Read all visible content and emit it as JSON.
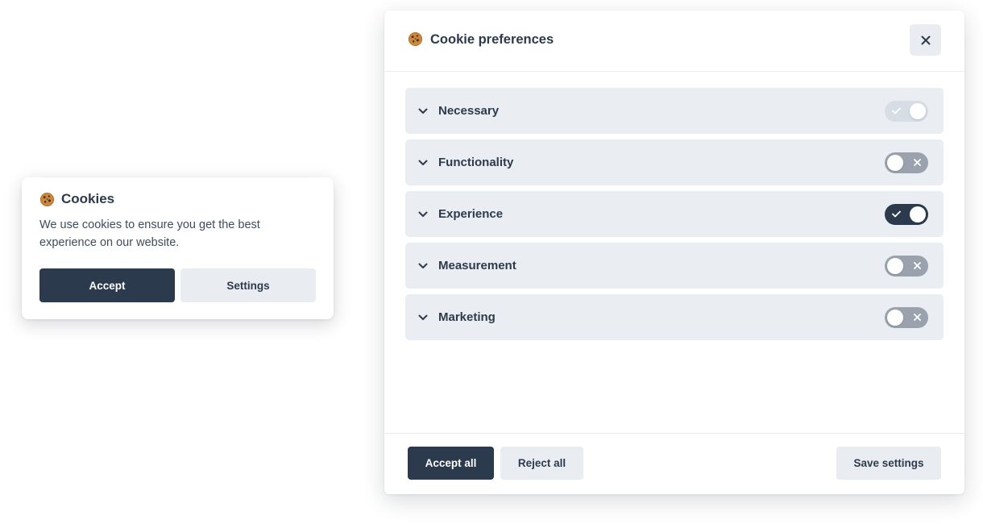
{
  "banner": {
    "icon": "cookie-icon",
    "title": "Cookies",
    "text": "We use cookies to ensure you get the best experience on our website.",
    "accept_label": "Accept",
    "settings_label": "Settings"
  },
  "modal": {
    "icon": "cookie-icon",
    "title": "Cookie preferences",
    "close_icon": "close-icon",
    "categories": [
      {
        "label": "Necessary",
        "state": "on-disabled"
      },
      {
        "label": "Functionality",
        "state": "off"
      },
      {
        "label": "Experience",
        "state": "on"
      },
      {
        "label": "Measurement",
        "state": "off"
      },
      {
        "label": "Marketing",
        "state": "off"
      }
    ],
    "accept_all_label": "Accept all",
    "reject_all_label": "Reject all",
    "save_label": "Save settings"
  },
  "colors": {
    "primary_dark": "#2c3a4d",
    "secondary_light": "#e9edf2",
    "category_bg": "#eaeef3",
    "toggle_off": "#9aa3ad",
    "toggle_disabled": "#d7dde4"
  }
}
